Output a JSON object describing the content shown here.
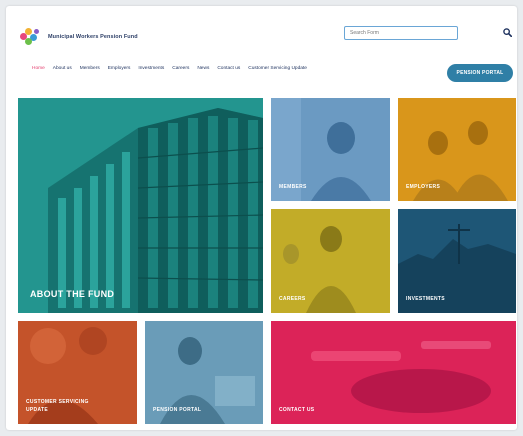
{
  "header": {
    "logo_text": "Municipal Workers Pension Fund",
    "search_placeholder": "Search Form",
    "portal_button": "PENSION PORTAL"
  },
  "nav": {
    "items": [
      "Home",
      "About us",
      "Members",
      "Employers",
      "Investments",
      "Careers",
      "News",
      "Contact us",
      "Customer Servicing Update"
    ],
    "active": "Home"
  },
  "tiles": {
    "about": "ABOUT THE FUND",
    "members": "MEMBERS",
    "employers": "EMPLOYERS",
    "careers": "CAREERS",
    "investments": "INVESTMENTS",
    "customer_line1": "CUSTOMER SERVICING",
    "customer_line2": "UPDATE",
    "portal": "PENSION PORTAL",
    "contact": "CONTACT US"
  },
  "colors": {
    "about": "#1f8f8a",
    "members": "#5f8fb8",
    "employers": "#d99a1a",
    "careers": "#c9b32a",
    "investments": "#1d5a7a",
    "customer": "#c5532a",
    "portal": "#5f96b3",
    "contact": "#e0215a",
    "nav_active": "#e33c6c",
    "portal_button": "#2f7fa6"
  }
}
